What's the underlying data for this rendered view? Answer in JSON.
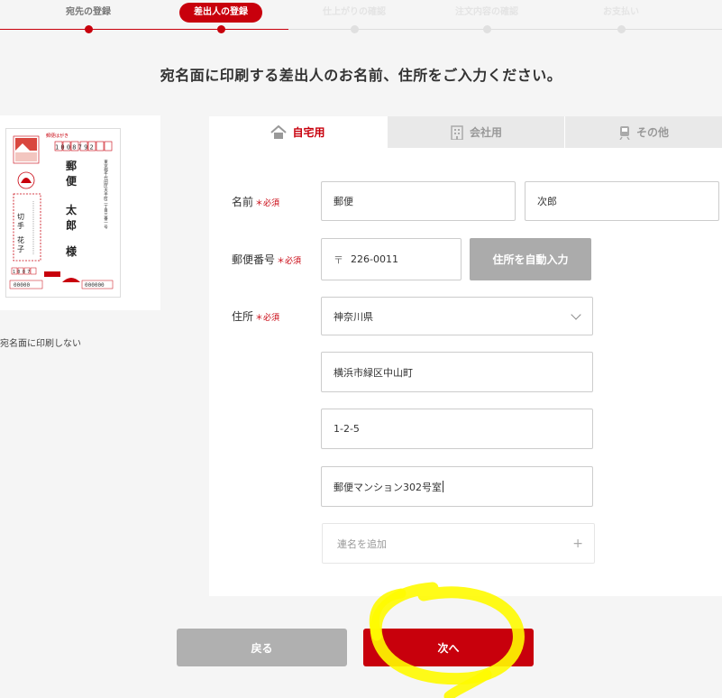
{
  "stepper": {
    "steps": [
      {
        "label": "宛先の登録",
        "state": "done"
      },
      {
        "label": "差出人の登録",
        "state": "active"
      },
      {
        "label": "仕上がりの確認",
        "state": "todo"
      },
      {
        "label": "注文内容の確認",
        "state": "todo"
      },
      {
        "label": "お支払い",
        "state": "todo"
      }
    ]
  },
  "page_title": "宛名面に印刷する差出人のお名前、住所をご入力ください。",
  "preview": {
    "no_print_label": "宛名面に印刷しない",
    "postcard": {
      "header": "郵便はがき",
      "recipient_zip": "1008792",
      "recipient_name_chars": [
        "郵",
        "便",
        "太",
        "郎",
        "様"
      ],
      "recipient_address": "東京都千代田区大手町二丁目三番一号",
      "sender_name_chars": [
        "切",
        "手",
        "花",
        "子"
      ],
      "sender_zip_box": "1007",
      "footer_left": "00000",
      "footer_right": "000000"
    }
  },
  "tabs": [
    {
      "label": "自宅用",
      "icon": "house-icon",
      "active": true
    },
    {
      "label": "会社用",
      "icon": "building-icon",
      "active": false
    },
    {
      "label": "その他",
      "icon": "train-icon",
      "active": false
    }
  ],
  "form": {
    "required_mark": "＊必須",
    "name_label": "名前",
    "last_name": "郵便",
    "first_name": "次郎",
    "zip_label": "郵便番号",
    "zip_symbol": "〒",
    "zip_value": "226-0011",
    "auto_address_button": "住所を自動入力",
    "address_label": "住所",
    "prefecture": "神奈川県",
    "city": "横浜市緑区中山町",
    "street": "1-2-5",
    "building": "郵便マンション302号室",
    "joint_name_placeholder": "連名を追加",
    "plus_icon": "+"
  },
  "buttons": {
    "back": "戻る",
    "next": "次へ"
  },
  "colors": {
    "accent": "#c8000c",
    "disabled_button": "#b0b0b0",
    "highlight": "#fffb00"
  }
}
